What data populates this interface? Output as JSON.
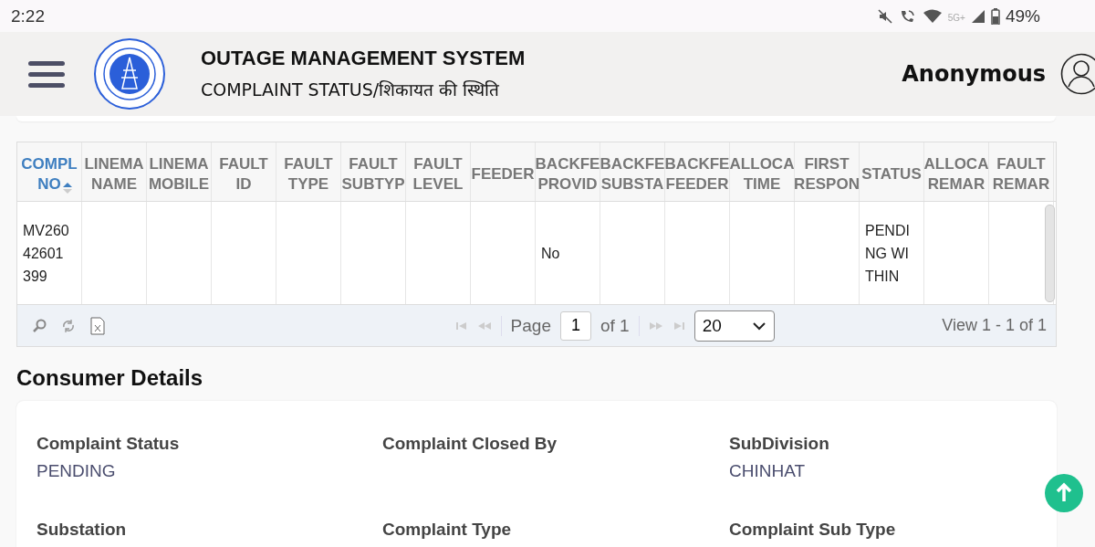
{
  "status_bar": {
    "time": "2:22",
    "network": "5G+",
    "battery": "49%"
  },
  "header": {
    "title": "OUTAGE MANAGEMENT SYSTEM",
    "subtitle": "COMPLAINT STATUS/शिकायत की स्थिति",
    "user": "Anonymous"
  },
  "table": {
    "columns": [
      {
        "label": "COMPL\nNO",
        "sorted": true
      },
      {
        "label": "LINEMA\nNAME",
        "sorted": false
      },
      {
        "label": "LINEMA\nMOBILE",
        "sorted": false
      },
      {
        "label": "FAULT\nID",
        "sorted": false
      },
      {
        "label": "FAULT\nTYPE",
        "sorted": false
      },
      {
        "label": "FAULT\nSUBTYP",
        "sorted": false
      },
      {
        "label": "FAULT\nLEVEL",
        "sorted": false
      },
      {
        "label": "FEEDER",
        "sorted": false
      },
      {
        "label": "BACKFE\nPROVID",
        "sorted": false
      },
      {
        "label": "BACKFE\nSUBSTA",
        "sorted": false
      },
      {
        "label": "BACKFE\nFEEDER",
        "sorted": false
      },
      {
        "label": "ALLOCA\nTIME",
        "sorted": false
      },
      {
        "label": "FIRST\nRESPON",
        "sorted": false
      },
      {
        "label": "STATUS",
        "sorted": false
      },
      {
        "label": "ALLOCA\nREMAR",
        "sorted": false
      },
      {
        "label": "FAULT\nREMAR",
        "sorted": false
      }
    ],
    "rows": [
      {
        "cells": [
          "MV26042601399",
          "",
          "",
          "",
          "",
          "",
          "",
          "",
          "No",
          "",
          "",
          "",
          "",
          "PENDING WITHIN",
          "",
          ""
        ]
      }
    ],
    "pager": {
      "page_label": "Page",
      "page": "1",
      "of": "of 1",
      "page_size": "20",
      "view": "View 1 - 1 of 1"
    }
  },
  "consumer_details": {
    "title": "Consumer Details",
    "fields": [
      {
        "label": "Complaint Status",
        "value": "PENDING"
      },
      {
        "label": "Complaint Closed By"
      },
      {
        "label": "SubDivision",
        "value": "CHINHAT"
      },
      {
        "label": "Substation"
      },
      {
        "label": "Complaint Type"
      },
      {
        "label": "Complaint Sub Type"
      }
    ]
  }
}
